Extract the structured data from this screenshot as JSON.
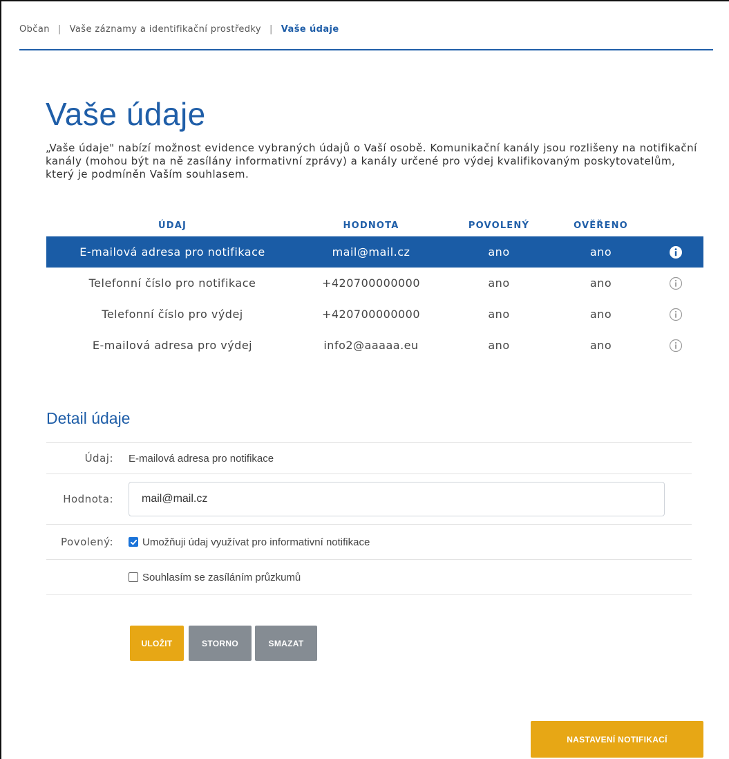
{
  "breadcrumb": {
    "items": [
      "Občan",
      "Vaše záznamy a identifikační prostředky",
      "Vaše údaje"
    ],
    "separator": "|"
  },
  "page": {
    "title": "Vaše údaje",
    "description": "„Vaše údaje\" nabízí možnost evidence vybraných údajů o Vaší osobě. Komunikační kanály jsou rozlišeny na notifikační kanály (mohou být na ně zasílány informativní zprávy) a kanály určené pro výdej kvalifikovaným poskytovatelům, který je podmíněn Vaším souhlasem."
  },
  "table": {
    "headers": [
      "ÚDAJ",
      "HODNOTA",
      "POVOLENÝ",
      "OVĚŘENO"
    ],
    "rows": [
      {
        "udaj": "E-mailová adresa pro notifikace",
        "hodnota": "mail@mail.cz",
        "povoleny": "ano",
        "overeno": "ano",
        "selected": true
      },
      {
        "udaj": "Telefonní číslo pro notifikace",
        "hodnota": "+420700000000",
        "povoleny": "ano",
        "overeno": "ano",
        "selected": false
      },
      {
        "udaj": "Telefonní číslo pro výdej",
        "hodnota": "+420700000000",
        "povoleny": "ano",
        "overeno": "ano",
        "selected": false
      },
      {
        "udaj": "E-mailová adresa pro výdej",
        "hodnota": "info2@aaaaa.eu",
        "povoleny": "ano",
        "overeno": "ano",
        "selected": false
      }
    ],
    "info_icon": "info-circle-icon"
  },
  "detail": {
    "title": "Detail údaje",
    "udaj_label": "Údaj:",
    "udaj_value": "E-mailová adresa pro notifikace",
    "hodnota_label": "Hodnota:",
    "hodnota_value": "mail@mail.cz",
    "povoleny_label": "Povolený:",
    "notif_checkbox_label": "Umožňuji údaj využívat pro informativní notifikace",
    "notif_checked": true,
    "survey_checkbox_label": "Souhlasím se zasíláním průzkumů",
    "survey_checked": false
  },
  "buttons": {
    "save": "ULOŽIT",
    "cancel": "STORNO",
    "delete": "SMAZAT",
    "notification_settings": "NASTAVENÍ NOTIFIKACÍ"
  },
  "colors": {
    "primary": "#1f5ea8",
    "selected_row": "#1a5ca6",
    "accent_button": "#e7a715",
    "secondary_button": "#858c93",
    "checkbox": "#1a73d9"
  }
}
